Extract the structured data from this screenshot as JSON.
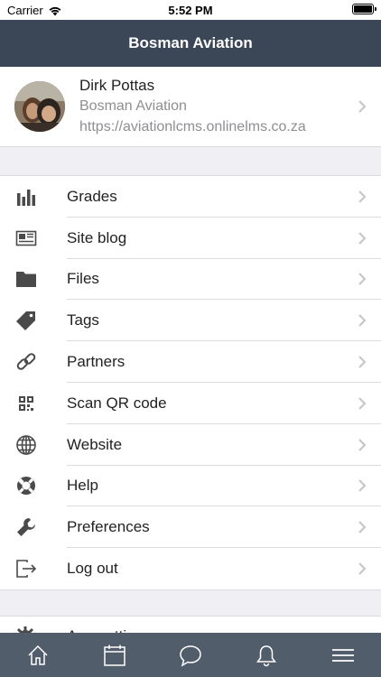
{
  "status_bar": {
    "carrier": "Carrier",
    "time": "5:52 PM"
  },
  "header": {
    "title": "Bosman Aviation"
  },
  "profile": {
    "name": "Dirk Pottas",
    "site_name": "Bosman Aviation",
    "site_url": "https://aviationlcms.onlinelms.co.za"
  },
  "menu": {
    "items": [
      {
        "label": "Grades",
        "icon": "bar-chart-icon"
      },
      {
        "label": "Site blog",
        "icon": "newspaper-icon"
      },
      {
        "label": "Files",
        "icon": "folder-icon"
      },
      {
        "label": "Tags",
        "icon": "tag-icon"
      },
      {
        "label": "Partners",
        "icon": "link-icon"
      },
      {
        "label": "Scan QR code",
        "icon": "qr-code-icon"
      },
      {
        "label": "Website",
        "icon": "globe-icon"
      },
      {
        "label": "Help",
        "icon": "lifebuoy-icon"
      },
      {
        "label": "Preferences",
        "icon": "wrench-icon"
      },
      {
        "label": "Log out",
        "icon": "logout-icon"
      }
    ]
  },
  "second_menu": {
    "partial_label": "App settings",
    "icon": "gear-icon"
  },
  "tab_bar": {
    "tabs": [
      {
        "name": "home",
        "icon": "home-icon"
      },
      {
        "name": "calendar",
        "icon": "calendar-icon"
      },
      {
        "name": "messages",
        "icon": "chat-bubble-icon"
      },
      {
        "name": "notifications",
        "icon": "bell-icon"
      },
      {
        "name": "more",
        "icon": "hamburger-menu-icon"
      }
    ]
  },
  "colors": {
    "header_bg": "#3b4656",
    "tab_bar_bg": "#525d6c",
    "page_bg": "#efeff4",
    "secondary_text": "#8e8e93"
  }
}
